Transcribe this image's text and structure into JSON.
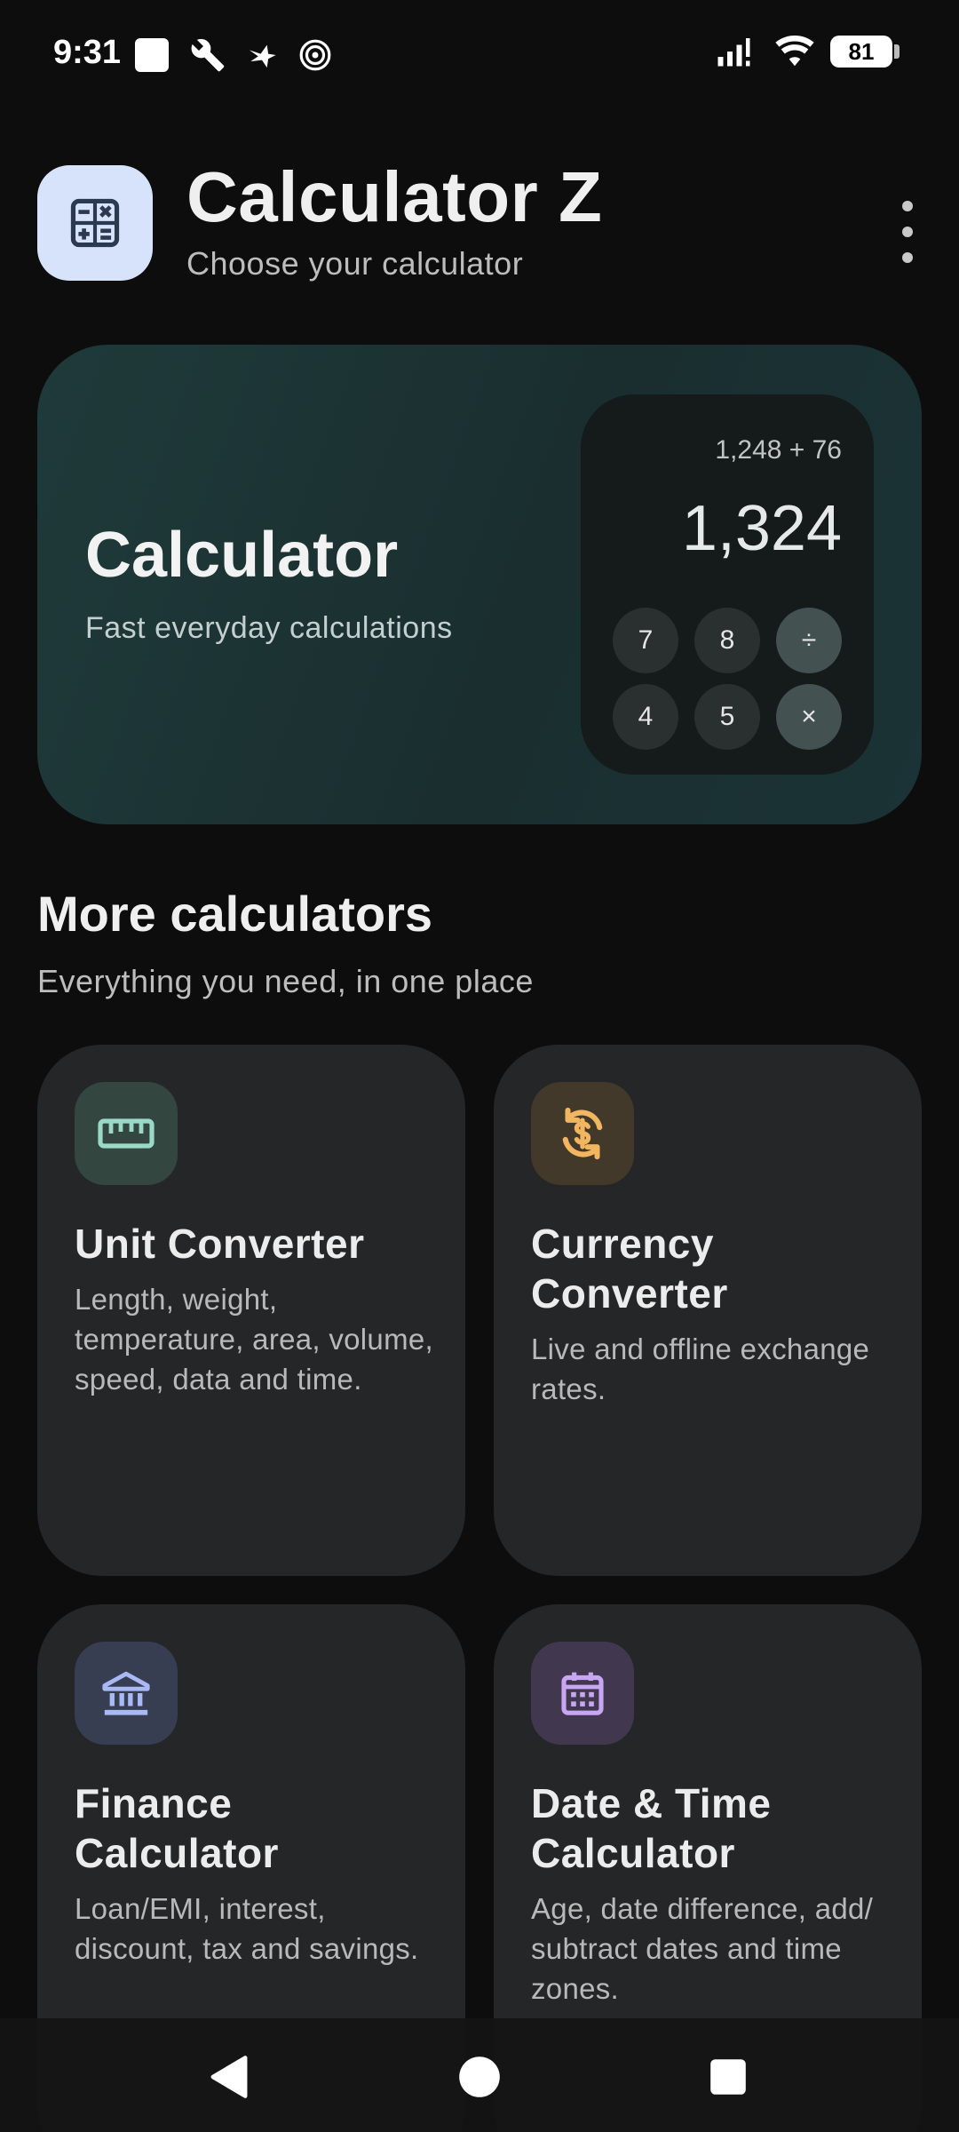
{
  "status_bar": {
    "time": "9:31",
    "battery": "81",
    "left_icons": [
      "square-notification-icon",
      "wrench-icon",
      "bird-icon",
      "spiral-icon"
    ],
    "right_icons": [
      "signal-icon",
      "wifi-icon",
      "battery-icon"
    ]
  },
  "header": {
    "title": "Calculator Z",
    "subtitle": "Choose your calculator",
    "icon": "calculator-icon",
    "menu_icon": "overflow-menu-icon"
  },
  "hero": {
    "title": "Calculator",
    "subtitle": "Fast everyday calculations",
    "preview": {
      "expression": "1,248 + 76",
      "result": "1,324",
      "keys": [
        "7",
        "8",
        "÷",
        "4",
        "5",
        "×"
      ]
    }
  },
  "section": {
    "title": "More calculators",
    "subtitle": "Everything you need, in one place"
  },
  "cards": [
    {
      "title": "Unit Converter",
      "description": "Length, weight, temperature, area, volume, speed, data and time.",
      "icon": "ruler-icon",
      "accent": "#9ad9c5"
    },
    {
      "title": "Currency Converter",
      "description": "Live and offline exchange rates.",
      "icon": "currency-exchange-icon",
      "accent": "#f2b661"
    },
    {
      "title": "Finance Calculator",
      "description": "Loan/EMI, interest, discount, tax and savings.",
      "icon": "bank-icon",
      "accent": "#a9b9f5"
    },
    {
      "title": "Date & Time Calculator",
      "description": "Age, date difference, add/ subtract dates and time zones.",
      "icon": "calendar-icon",
      "accent": "#c8a6f2"
    }
  ],
  "nav": {
    "back": "back-icon",
    "home": "home-icon",
    "recents": "recents-icon"
  },
  "colors": {
    "background": "#0d0d0d",
    "card": "#252628",
    "hero_gradient_start": "#1f3a3a",
    "hero_gradient_end": "#1b3336"
  }
}
